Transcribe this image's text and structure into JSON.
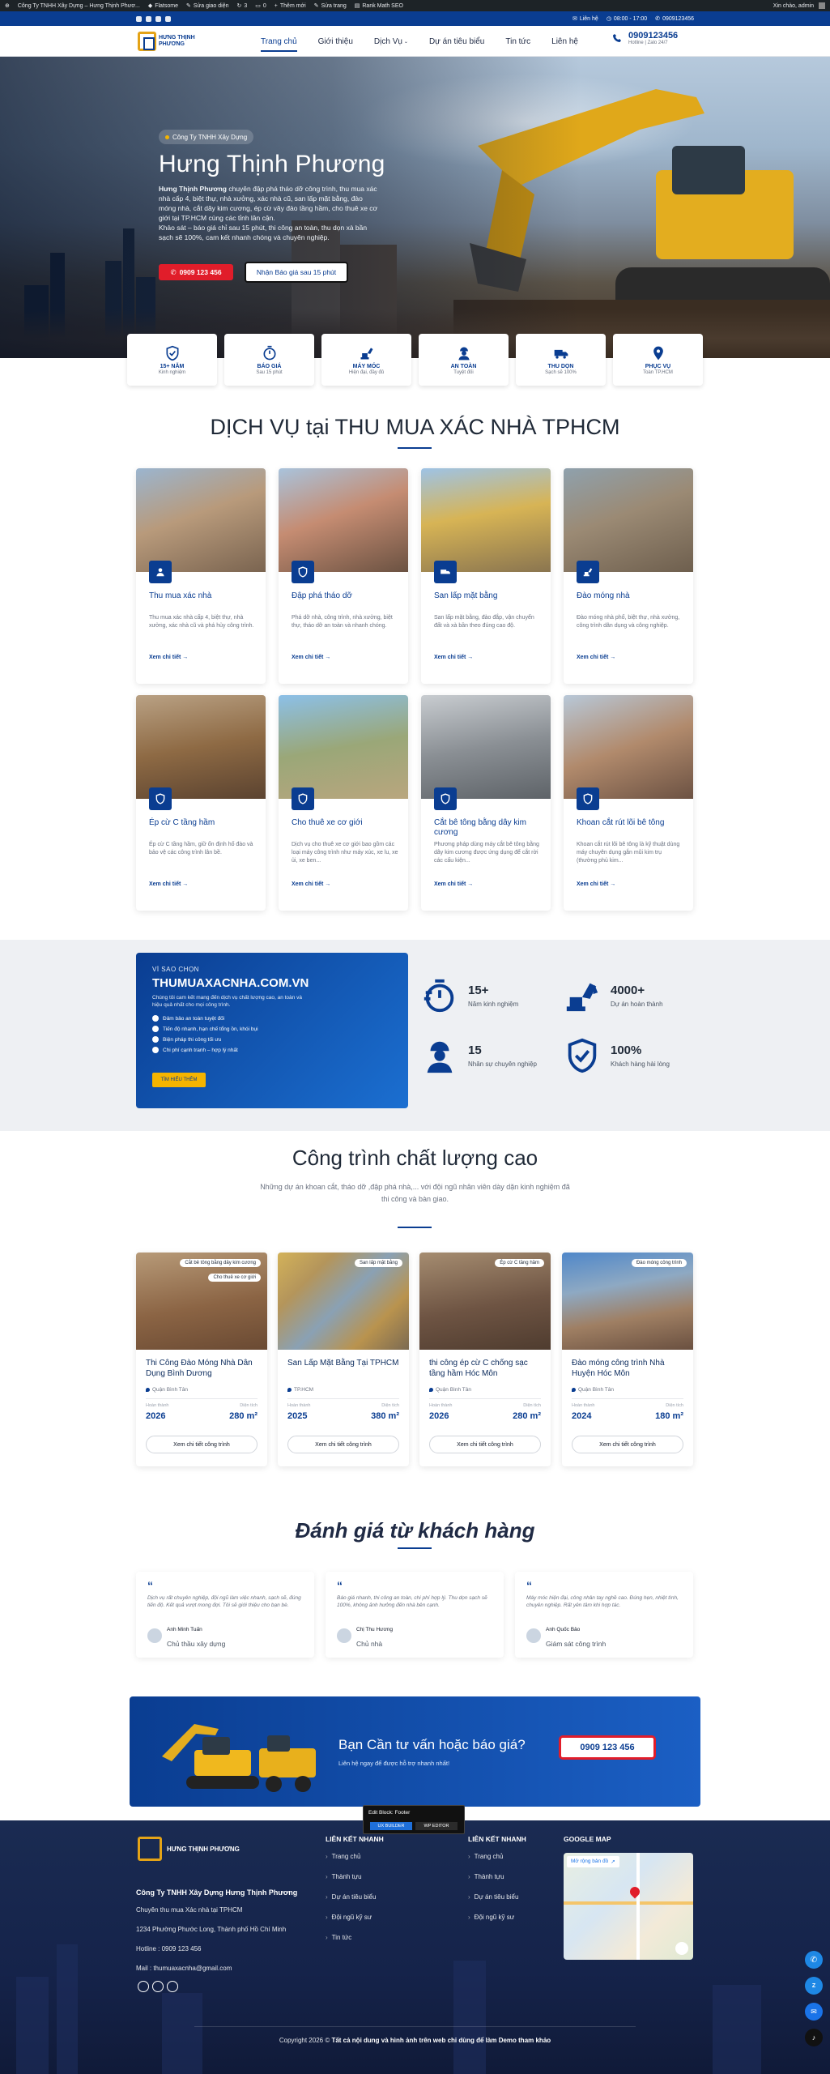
{
  "adminbar": {
    "site": "Công Ty TNHH Xây Dựng – Hưng Thịnh Phươ...",
    "flatsome": "Flatsome",
    "edit_ui": "Sửa giao diện",
    "updates": "3",
    "comments": "0",
    "new": "Thêm mới",
    "edit_page": "Sửa trang",
    "rankmath": "Rank Math SEO",
    "greeting": "Xin chào, admin"
  },
  "topbar": {
    "contact": "Liên hệ",
    "hours": "08:00 - 17:00",
    "phone": "0909123456"
  },
  "header": {
    "logo_text": "HƯNG THỊNH PHƯƠNG",
    "nav": [
      "Trang chủ",
      "Giới thiệu",
      "Dịch Vụ",
      "Dự án tiêu biểu",
      "Tin tức",
      "Liên hệ"
    ],
    "hotline_number": "0909123456",
    "hotline_sub": "Hotline | Zalo 24/7"
  },
  "hero": {
    "pill": "Công Ty TNHH Xây Dựng",
    "title": "Hưng Thịnh Phương",
    "desc_bold": "Hưng Thịnh Phương",
    "desc": " chuyên đập phá tháo dỡ công trình, thu mua xác nhà cấp 4, biệt thự, nhà xưởng, xác nhà cũ, san lấp mặt bằng, đào móng nhà, cắt dây kim cương, ép cừ vây đào tầng hầm, cho thuê xe cơ giới tại TP.HCM cùng các tỉnh lân cận.",
    "desc2": "Khảo sát – báo giá chỉ sau 15 phút, thi công an toàn, thu dọn xà bần sạch sẽ 100%, cam kết nhanh chóng và chuyên nghiệp.",
    "call_button": "0909 123 456",
    "quote_button": "Nhận Báo giá sau 15 phút"
  },
  "features": [
    {
      "title": "15+ NĂM",
      "sub": "Kinh nghiệm",
      "icon": "shield-check-icon"
    },
    {
      "title": "BÁO GIÁ",
      "sub": "Sau 15 phút",
      "icon": "stopwatch-icon"
    },
    {
      "title": "MÁY MÓC",
      "sub": "Hiện đại, đầy đủ",
      "icon": "excavator-icon"
    },
    {
      "title": "AN TOÀN",
      "sub": "Tuyệt đối",
      "icon": "worker-icon"
    },
    {
      "title": "THU DỌN",
      "sub": "Sạch sẽ 100%",
      "icon": "truck-icon"
    },
    {
      "title": "PHỤC VỤ",
      "sub": "Toàn TP.HCM",
      "icon": "map-pin-icon"
    }
  ],
  "services_section": {
    "title": "DỊCH VỤ tại THU MUA XÁC NHÀ TPHCM"
  },
  "services": [
    {
      "title": "Thu mua xác nhà",
      "text": "Thu mua xác nhà cấp 4, biệt thự, nhà xưởng, xác nhà cũ và phá hủy công trình.",
      "more": "Xem chi tiết →"
    },
    {
      "title": "Đập phá tháo dỡ",
      "text": "Phá dỡ nhà, công trình, nhà xưởng, biệt thự, tháo dỡ an toàn và nhanh chóng.",
      "more": "Xem chi tiết →"
    },
    {
      "title": "San lấp mặt bằng",
      "text": "San lấp mặt bằng, đào đắp, vận chuyển đất và xà bần theo đúng cao độ.",
      "more": "Xem chi tiết →"
    },
    {
      "title": "Đào móng nhà",
      "text": "Đào móng nhà phố, biệt thự, nhà xưởng, công trình dân dụng và công nghiệp.",
      "more": "Xem chi tiết →"
    },
    {
      "title": "Ép cừ C tầng hầm",
      "text": "Ép cừ C tầng hầm, giữ ổn định hố đào và bảo vệ các công trình lân bề.",
      "more": "Xem chi tiết →"
    },
    {
      "title": "Cho thuê xe cơ giới",
      "text": "Dịch vụ cho thuê xe cơ giới bao gồm các loại máy công trình như máy xúc, xe lu, xe ủi, xe ben...",
      "more": "Xem chi tiết →"
    },
    {
      "title": "Cắt bê tông bằng dây kim cương",
      "text": "Phương pháp dùng máy cắt bê tông bằng dây kim cương được ứng dụng để cắt rời các cấu kiện...",
      "more": "Xem chi tiết →"
    },
    {
      "title": "Khoan cắt rút lõi bê tông",
      "text": "Khoan cắt rút lõi bê tông là kỹ thuật dùng máy chuyên dụng gắn mũi kim trụ (thường phủ kim...",
      "more": "Xem chi tiết →"
    }
  ],
  "why": {
    "kicker": "VÌ SAO CHỌN",
    "heading": "THUMUAXACNHA.COM.VN",
    "para": "Chúng tôi cam kết mang đến dịch vụ chất lượng cao, an toàn và hiệu quả nhất cho mọi công trình.",
    "bullets": [
      "Đảm bảo an toàn tuyệt đối",
      "Tiến độ nhanh, hạn chế tổng ồn, khói bụi",
      "Biện pháp thi công tối ưu",
      "Chi phí cạnh tranh – hợp lý nhất"
    ],
    "button": "TÌM HIỂU THÊM"
  },
  "stats": [
    {
      "num": "15+",
      "label": "Năm kinh nghiệm",
      "icon": "stopwatch-icon"
    },
    {
      "num": "4000+",
      "label": "Dự án hoàn thành",
      "icon": "excavator-icon"
    },
    {
      "num": "15",
      "label": "Nhân sự chuyên nghiệp",
      "icon": "worker-icon"
    },
    {
      "num": "100%",
      "label": "Khách hàng hài lòng",
      "icon": "shield-check-icon"
    }
  ],
  "projects_section": {
    "title": "Công trình chất lượng cao",
    "sub": "Những dự án khoan cắt, tháo dỡ ,đập phá nhà,... với đội ngũ nhân viên dày dặn kinh nghiệm đã thi công và bàn giao."
  },
  "projects": [
    {
      "tags": [
        "Cắt bê tông bằng dây kim cương",
        "Cho thuê xe cơ giới"
      ],
      "title": "Thi Công Đào Móng Nhà Dân Dụng Bình Dương",
      "loc": "Quận Bình Tân",
      "lbl_done": "Hoàn thành",
      "lbl_area": "Diện tích",
      "year": "2026",
      "area": "280 m²",
      "button": "Xem chi tiết công trình"
    },
    {
      "tags": [
        "San lấp mặt bằng"
      ],
      "title": "San Lấp Mặt Bằng Tại TPHCM",
      "loc": "TP.HCM",
      "lbl_done": "Hoàn thành",
      "lbl_area": "Diện tích",
      "year": "2025",
      "area": "380 m²",
      "button": "Xem chi tiết công trình"
    },
    {
      "tags": [
        "Ép cừ C tầng hầm"
      ],
      "title": "thi công ép cừ C chống sạc tầng hầm Hóc Môn",
      "loc": "Quận Bình Tân",
      "lbl_done": "Hoàn thành",
      "lbl_area": "Diện tích",
      "year": "2026",
      "area": "280 m²",
      "button": "Xem chi tiết công trình"
    },
    {
      "tags": [
        "Đào móng công trình"
      ],
      "title": "Đào móng công trình Nhà Huyện Hóc Môn",
      "loc": "Quận Bình Tân",
      "lbl_done": "Hoàn thành",
      "lbl_area": "Diện tích",
      "year": "2024",
      "area": "180 m²",
      "button": "Xem chi tiết công trình"
    }
  ],
  "reviews_section": {
    "title": "Đánh giá từ khách hàng"
  },
  "reviews": [
    {
      "text": "Dịch vụ rất chuyên nghiệp, đội ngũ làm việc nhanh, sạch sẽ, đúng tiến độ. Kết quả vượt mong đợi. Tôi sẽ giới thiệu cho bạn bè.",
      "name": "Anh Minh Tuấn",
      "role": "Chủ thầu xây dựng"
    },
    {
      "text": "Báo giá nhanh, thi công an toàn, chi phí hợp lý. Thu dọn sạch sẽ 100%, không ảnh hưởng đến nhà bên cạnh.",
      "name": "Chị Thu Hương",
      "role": "Chủ nhà"
    },
    {
      "text": "Máy móc hiện đại, công nhân tay nghề cao. Đúng hẹn, nhiệt tình, chuyên nghiệp. Rất yên tâm khi hợp tác.",
      "name": "Anh Quốc Bảo",
      "role": "Giám sát công trình"
    }
  ],
  "cta": {
    "title": "Bạn Cần tư vấn hoặc báo giá?",
    "sub": "Liên hệ ngay để được hỗ trợ nhanh nhất!",
    "button": "0909 123 456"
  },
  "editor_tip": {
    "title": "Edit Block: Footer",
    "btn1": "UX BUILDER",
    "btn2": "WP EDITOR"
  },
  "footer": {
    "logo_text": "HƯNG THỊNH PHƯƠNG",
    "company": "Công Ty TNHH Xây Dựng Hưng Thịnh Phương",
    "tagline": "Chuyên thu mua Xác nhà tại TPHCM",
    "address": "1234 Phường Phước Long, Thành phố Hồ Chí Minh",
    "hotline": "Hotline : 0909 123 456",
    "mail": "Mail : thumuaxacnha@gmail.com",
    "col1_title": "LIÊN KẾT NHANH",
    "col1_links": [
      "Trang chủ",
      "Thành tựu",
      "Dự án tiêu biểu",
      "Đội ngũ kỹ sư",
      "Tin tức"
    ],
    "col2_title": "LIÊN KẾT NHANH",
    "col2_links": [
      "Trang chủ",
      "Thành tựu",
      "Dự án tiêu biểu",
      "Đội ngũ kỹ sư"
    ],
    "col3_title": "GOOGLE MAP",
    "map_link": "Mở rộng bản đồ",
    "copyright_pre": "Copyright 2026 © ",
    "copyright_bold": "Tất cả nội dung và hình ảnh trên web chỉ dùng để làm Demo tham khảo"
  }
}
